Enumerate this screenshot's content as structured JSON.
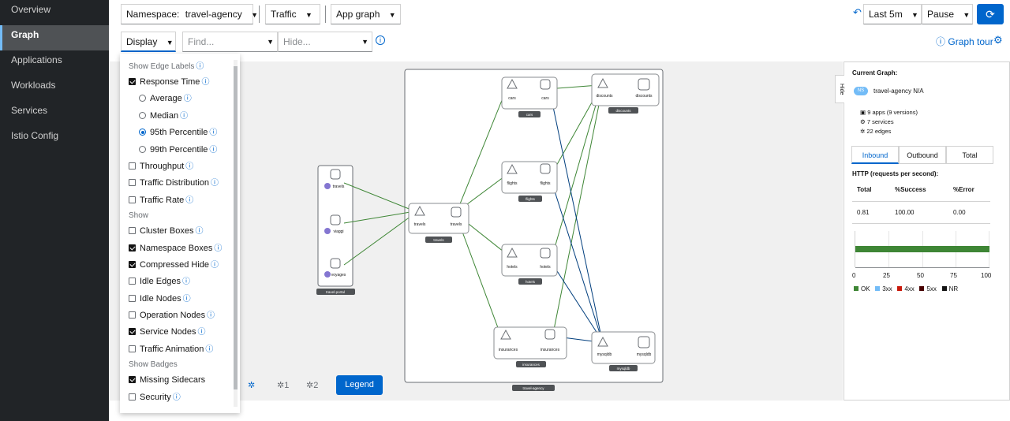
{
  "sidebar": {
    "items": [
      {
        "label": "Overview",
        "active": false
      },
      {
        "label": "Graph",
        "active": true
      },
      {
        "label": "Applications",
        "active": false
      },
      {
        "label": "Workloads",
        "active": false
      },
      {
        "label": "Services",
        "active": false
      },
      {
        "label": "Istio Config",
        "active": false
      }
    ]
  },
  "toolbar": {
    "namespace_label": "Namespace:",
    "namespace_value": "travel-agency",
    "traffic_label": "Traffic",
    "graph_type_label": "App graph",
    "time_range_label": "Last 5m",
    "refresh_label": "Pause"
  },
  "toolbar2": {
    "display_label": "Display",
    "find_placeholder": "Find...",
    "hide_placeholder": "Hide...",
    "graph_tour_label": "Graph tour"
  },
  "display_menu": {
    "sections": [
      {
        "header": "Show Edge Labels"
      },
      {
        "header": "Show"
      },
      {
        "header": "Show Badges"
      }
    ],
    "edge_labels": [
      {
        "label": "Response Time",
        "type": "checkbox",
        "checked": true
      },
      {
        "label": "Average",
        "type": "radio",
        "checked": false
      },
      {
        "label": "Median",
        "type": "radio",
        "checked": false
      },
      {
        "label": "95th Percentile",
        "type": "radio",
        "checked": true
      },
      {
        "label": "99th Percentile",
        "type": "radio",
        "checked": false
      },
      {
        "label": "Throughput",
        "type": "checkbox",
        "checked": false
      },
      {
        "label": "Traffic Distribution",
        "type": "checkbox",
        "checked": false
      },
      {
        "label": "Traffic Rate",
        "type": "checkbox",
        "checked": false
      }
    ],
    "show": [
      {
        "label": "Cluster Boxes",
        "checked": false
      },
      {
        "label": "Namespace Boxes",
        "checked": true
      },
      {
        "label": "Compressed Hide",
        "checked": true
      },
      {
        "label": "Idle Edges",
        "checked": false
      },
      {
        "label": "Idle Nodes",
        "checked": false
      },
      {
        "label": "Operation Nodes",
        "checked": false
      },
      {
        "label": "Service Nodes",
        "checked": true
      },
      {
        "label": "Traffic Animation",
        "checked": false
      }
    ],
    "badges": [
      {
        "label": "Missing Sidecars",
        "checked": true
      },
      {
        "label": "Security",
        "checked": false
      }
    ]
  },
  "graph_toolbar": {
    "layout1": "1",
    "layout2": "2",
    "legend_label": "Legend"
  },
  "graph": {
    "ns_badge": "NS",
    "app_badge": "A",
    "namespaces": [
      "travel-portal",
      "travel-agency"
    ],
    "portal_nodes": [
      "travels",
      "viaggi",
      "voyages"
    ],
    "agency_apps": [
      "travels",
      "cars",
      "flights",
      "hotels",
      "insurances",
      "discounts",
      "mysqldb"
    ]
  },
  "side_panel": {
    "hide_label": "Hide",
    "current_graph_label": "Current Graph:",
    "ns_badge": "NS",
    "namespace": "travel-agency",
    "namespace_suffix": "N/A",
    "apps": "9 apps (9 versions)",
    "services": "7 services",
    "edges": "22 edges",
    "tabs": [
      "Inbound",
      "Outbound",
      "Total"
    ],
    "http_label": "HTTP (requests per second):",
    "table_headers": [
      "Total",
      "%Success",
      "%Error"
    ],
    "table_values": [
      "0.81",
      "100.00",
      "0.00"
    ],
    "axis_ticks": [
      "0",
      "25",
      "50",
      "75",
      "100"
    ],
    "legend": [
      {
        "label": "OK",
        "color": "#3e8635"
      },
      {
        "label": "3xx",
        "color": "#73bcf7"
      },
      {
        "label": "4xx",
        "color": "#c9190b"
      },
      {
        "label": "5xx",
        "color": "#470000"
      },
      {
        "label": "NR",
        "color": "#151515"
      }
    ],
    "ok_percent": 100
  },
  "colors": {
    "edge_ok": "#3e8635",
    "edge_tcp": "#003e7d",
    "accent": "#0066cc"
  }
}
